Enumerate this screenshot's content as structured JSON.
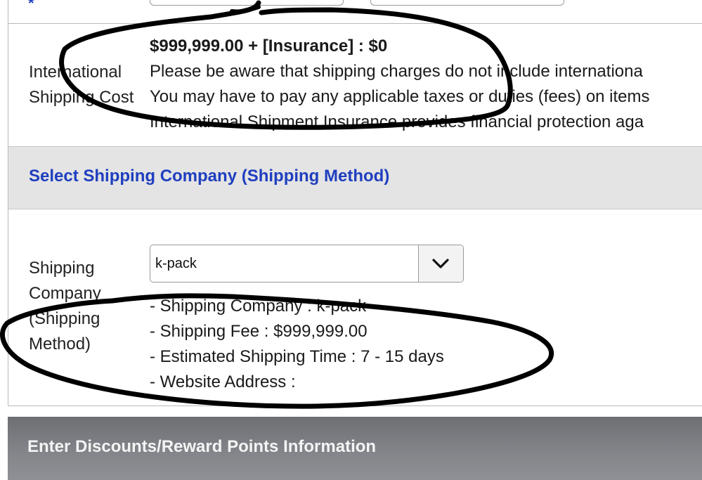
{
  "top": {
    "required_mark": "*"
  },
  "international_shipping": {
    "label_line1": "International",
    "label_line2": "Shipping Cost",
    "cost_line": "$999,999.00 + [Insurance] : $0",
    "notes": [
      "Please be aware that shipping charges do not include internationa",
      "You may have to pay any applicable taxes or duties (fees) on items",
      "International Shipment Insurance provides financial protection aga"
    ]
  },
  "shipping_section": {
    "title": "Select Shipping Company (Shipping Method)"
  },
  "shipping_company": {
    "label_lines": [
      "Shipping",
      "Company",
      "(Shipping",
      "Method)"
    ],
    "selected": "k-pack",
    "details": [
      "- Shipping Company : k-pack",
      "- Shipping Fee : $999,999.00",
      "- Estimated Shipping Time : 7 - 15 days",
      "- Website Address :"
    ]
  },
  "discount_section": {
    "title": "Enter Discounts/Reward Points Information"
  },
  "colors": {
    "accent_blue": "#1f3fbf",
    "section_gray": "#e4e4e4",
    "dark_bar": "#7a7c81",
    "marker": "#000000"
  },
  "icons": {
    "dropdown": "chevron-down-icon"
  }
}
